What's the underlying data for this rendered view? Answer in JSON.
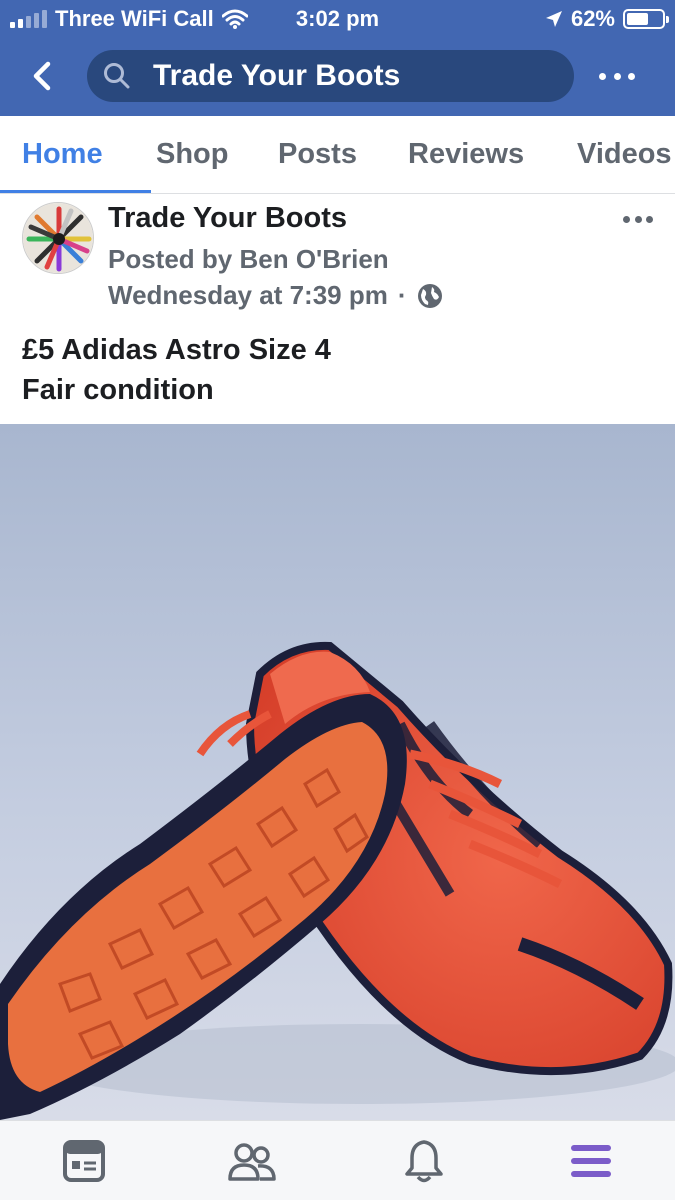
{
  "status_bar": {
    "carrier": "Three WiFi Call",
    "time": "3:02 pm",
    "battery_percent": "62%",
    "battery_level": 0.62,
    "icons": [
      "signal-icon",
      "wifi-icon",
      "location-arrow-icon",
      "battery-icon"
    ]
  },
  "nav": {
    "search_title": "Trade Your Boots",
    "icons": [
      "back-chevron-icon",
      "search-icon",
      "more-dots-icon"
    ]
  },
  "tabs": [
    {
      "label": "Home",
      "active": true
    },
    {
      "label": "Shop",
      "active": false
    },
    {
      "label": "Posts",
      "active": false
    },
    {
      "label": "Reviews",
      "active": false
    },
    {
      "label": "Videos",
      "active": false
    }
  ],
  "post": {
    "page_name": "Trade Your Boots",
    "posted_by": "Posted by Ben O'Brien",
    "timestamp": "Wednesday at 7:39 pm",
    "separator": "·",
    "text_line1": "£5 Adidas Astro Size 4",
    "text_line2": "Fair condition",
    "privacy_icon": "globe-icon"
  },
  "bottom_bar": {
    "items": [
      "news-feed-icon",
      "friends-icon",
      "notifications-bell-icon",
      "menu-icon"
    ]
  },
  "colors": {
    "brand_blue": "#4267b2",
    "search_pill": "#29487d",
    "active_tab": "#4080e5",
    "menu_purple": "#7b5cc9",
    "boot_orange": "#e8553a"
  }
}
